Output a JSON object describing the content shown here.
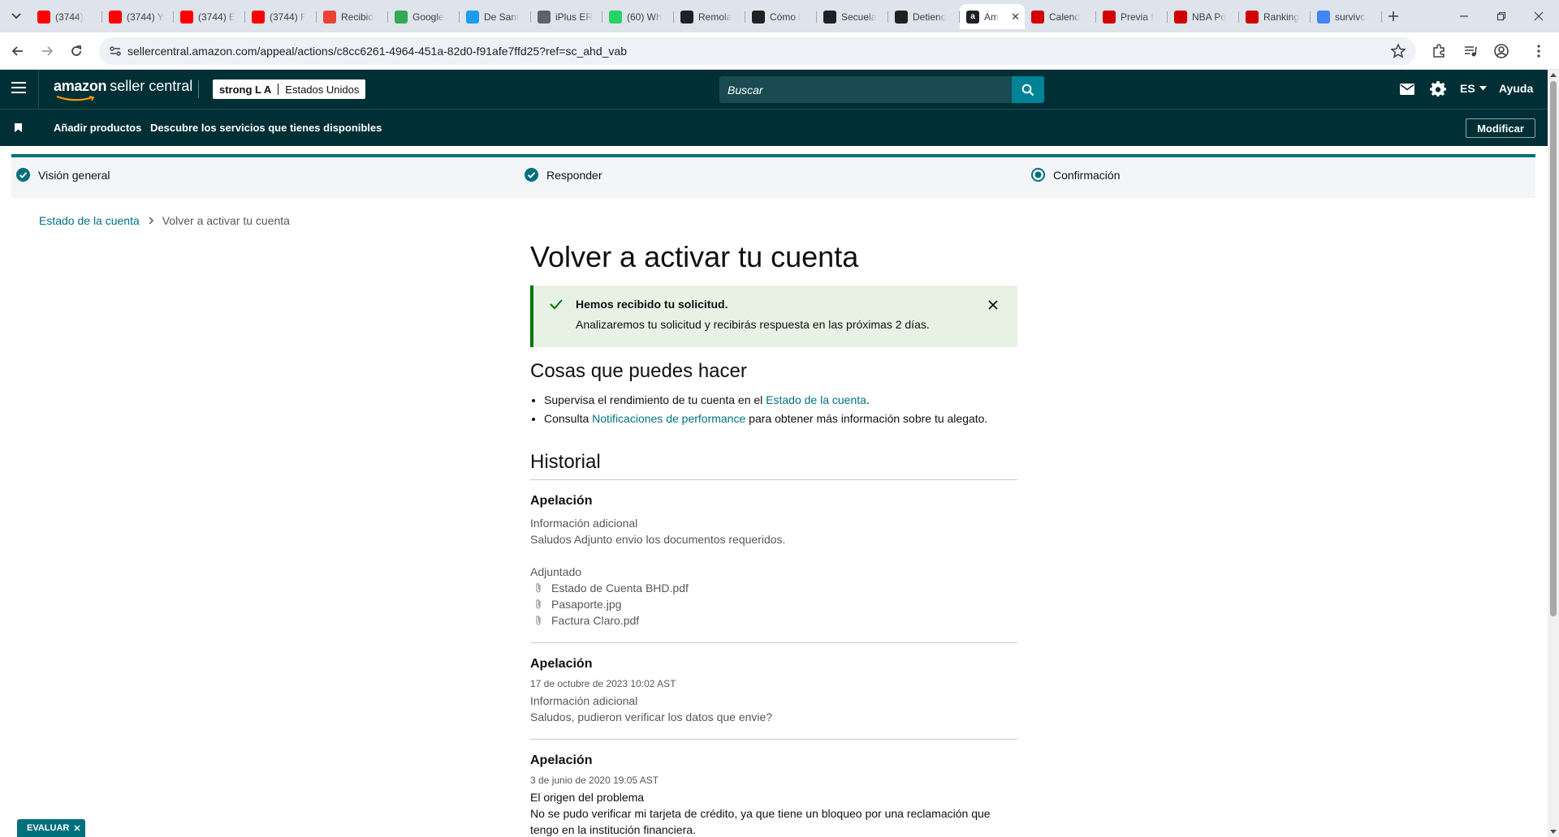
{
  "browser": {
    "tabs": [
      {
        "title": "(3744) ",
        "favicon": "youtube-icon",
        "color": "#ff0000"
      },
      {
        "title": "(3744) Y",
        "favicon": "youtube-icon",
        "color": "#ff0000"
      },
      {
        "title": "(3744) E",
        "favicon": "youtube-icon",
        "color": "#ff0000"
      },
      {
        "title": "(3744) F",
        "favicon": "youtube-icon",
        "color": "#ff0000"
      },
      {
        "title": "Recibid",
        "favicon": "gmail-icon",
        "color": "#ea4335"
      },
      {
        "title": "Google",
        "favicon": "google-play-icon",
        "color": "#34a853"
      },
      {
        "title": "De Sant",
        "favicon": "x-circle-icon",
        "color": "#1d9bf0"
      },
      {
        "title": "iPlus ER",
        "favicon": "globe-icon",
        "color": "#5f6368"
      },
      {
        "title": "(60) Wh",
        "favicon": "whatsapp-icon",
        "color": "#25d366"
      },
      {
        "title": "Remola",
        "favicon": "threads-icon",
        "color": "#202124"
      },
      {
        "title": "Cómo l",
        "favicon": "dots-icon",
        "color": "#202124"
      },
      {
        "title": "Secuela",
        "favicon": "threads-icon",
        "color": "#202124"
      },
      {
        "title": "Detienc",
        "favicon": "threads-icon",
        "color": "#202124"
      },
      {
        "title": "Am",
        "favicon": "amazon-icon",
        "color": "#202124",
        "active": true
      },
      {
        "title": "Calend",
        "favicon": "espn-icon",
        "color": "#d00000"
      },
      {
        "title": "Previa f",
        "favicon": "espn-icon",
        "color": "#d00000"
      },
      {
        "title": "NBA Po",
        "favicon": "espn-icon",
        "color": "#d00000"
      },
      {
        "title": "Ranking",
        "favicon": "espn-icon",
        "color": "#d00000"
      },
      {
        "title": "survivo",
        "favicon": "google-icon",
        "color": "#4285f4"
      }
    ],
    "url": "sellercentral.amazon.com/appeal/actions/c8cc6261-4964-451a-82d0-f91afe7ffd25?ref=sc_ahd_vab"
  },
  "header": {
    "logo_amazon": "amazon",
    "logo_product": "seller central",
    "account_name": "strong L A",
    "marketplace": "Estados Unidos",
    "search_placeholder": "Buscar",
    "language": "ES",
    "help": "Ayuda"
  },
  "bookmarks": {
    "items": [
      "Añadir productos",
      "Descubre los servicios que tienes disponibles"
    ],
    "edit_label": "Modificar"
  },
  "stepper": {
    "steps": [
      "Visión general",
      "Responder",
      "Confirmación"
    ]
  },
  "breadcrumb": {
    "parent": "Estado de la cuenta",
    "current": "Volver a activar tu cuenta"
  },
  "main": {
    "title": "Volver a activar tu cuenta",
    "alert": {
      "title": "Hemos recibido tu solicitud.",
      "text": "Analizaremos tu solicitud y recibirás respuesta en las próximas 2 días."
    },
    "things": {
      "heading": "Cosas que puedes hacer",
      "item1_pre": "Supervisa el rendimiento de tu cuenta en el ",
      "item1_link": "Estado de la cuenta",
      "item1_post": ".",
      "item2_pre": "Consulta ",
      "item2_link": "Notificaciones de performance",
      "item2_post": " para obtener más información sobre tu alegato."
    },
    "history": {
      "heading": "Historial",
      "entries": [
        {
          "title": "Apelación",
          "label": "Información adicional",
          "text": "Saludos Adjunto envio los documentos requeridos.",
          "attach_label": "Adjuntado",
          "attachments": [
            "Estado de Cuenta BHD.pdf",
            "Pasaporte.jpg",
            "Factura Claro.pdf"
          ]
        },
        {
          "title": "Apelación",
          "date": "17 de octubre de 2023 10:02 AST",
          "label": "Información adicional",
          "text": "Saludos, pudieron verificar los datos que envie?"
        },
        {
          "title": "Apelación",
          "date": "3 de junio de 2020 19:05 AST",
          "label": "El origen del problema",
          "text": "No se pudo verificar mi tarjeta de crédito, ya que tiene un bloqueo por una reclamación  que tengo en la institución financiera."
        }
      ]
    }
  },
  "feedback_label": "EVALUAR",
  "colors": {
    "header_bg": "#002f36",
    "accent": "#00707d",
    "link": "#007185",
    "success": "#007600"
  }
}
